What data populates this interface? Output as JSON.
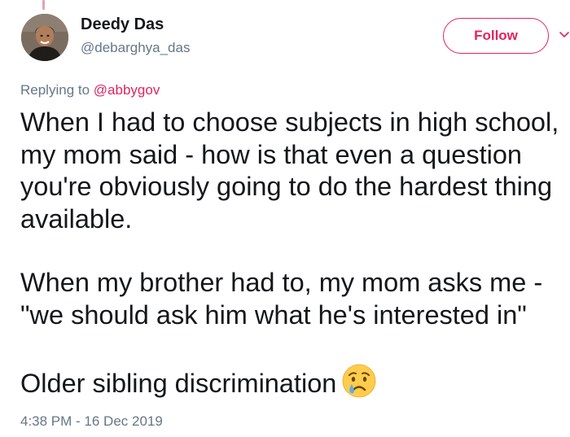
{
  "author": {
    "name": "Deedy Das",
    "handle": "@debarghya_das",
    "avatar": "avatar-photo"
  },
  "follow_button": {
    "label": "Follow",
    "color": "#e0245e"
  },
  "reply_context": {
    "prefix": "Replying to",
    "mention": "@abbygov"
  },
  "tweet": {
    "paragraphs": [
      "When I had to choose subjects in high school, my mom said - how is that even a question you're obviously going to do the hardest thing available.",
      "When my brother had to, my mom asks me - \"we should ask him what he's interested in\"",
      "Older sibling discrimination"
    ],
    "emoji": "crying-face-emoji"
  },
  "timestamp": "4:38 PM - 16 Dec 2019",
  "colors": {
    "text": "#14171a",
    "secondary": "#657786",
    "accent": "#e0245e"
  },
  "icons": {
    "menu": "chevron-down-icon"
  }
}
